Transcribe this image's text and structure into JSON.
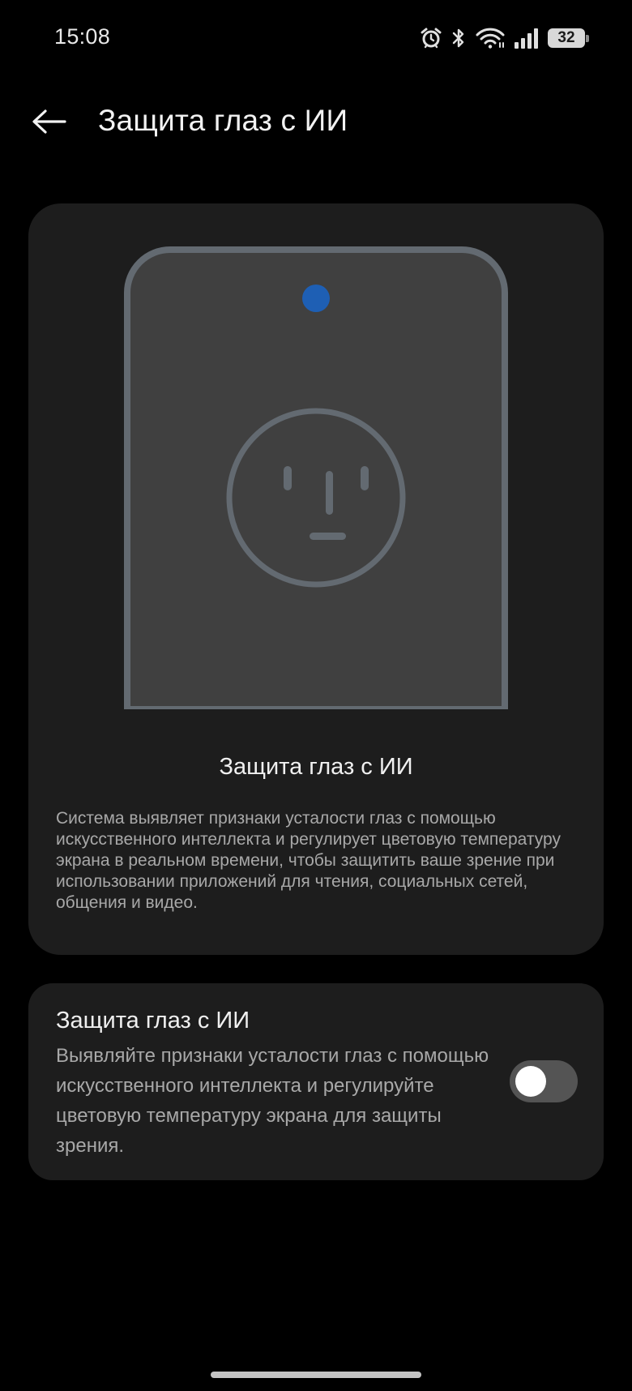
{
  "status_bar": {
    "time": "15:08",
    "battery_level": "32",
    "icons": [
      "alarm-icon",
      "bluetooth-icon",
      "wifi-icon",
      "signal-icon",
      "battery-icon"
    ]
  },
  "header": {
    "back_icon": "arrow-left-icon",
    "title": "Защита глаз с ИИ"
  },
  "info_card": {
    "illustration": "phone-with-face-icon",
    "heading": "Защита глаз с ИИ",
    "description": "Система выявляет признаки усталости глаз с помощью искусственного интеллекта и регулирует цветовую температуру экрана в реальном времени, чтобы защитить ваше зрение при использовании приложений для чтения, социальных сетей, общения и видео."
  },
  "setting": {
    "title": "Защита глаз с ИИ",
    "description": "Выявляйте признаки усталости глаз с помощью искусственного интеллекта и регулируйте цветовую температуру экрана для защиты зрения.",
    "enabled": false
  },
  "colors": {
    "background": "#000000",
    "card": "#1d1d1d",
    "phone_body": "#404040",
    "phone_outline": "#636a71",
    "camera_dot": "#1e5fb4",
    "switch_off": "#545454"
  }
}
